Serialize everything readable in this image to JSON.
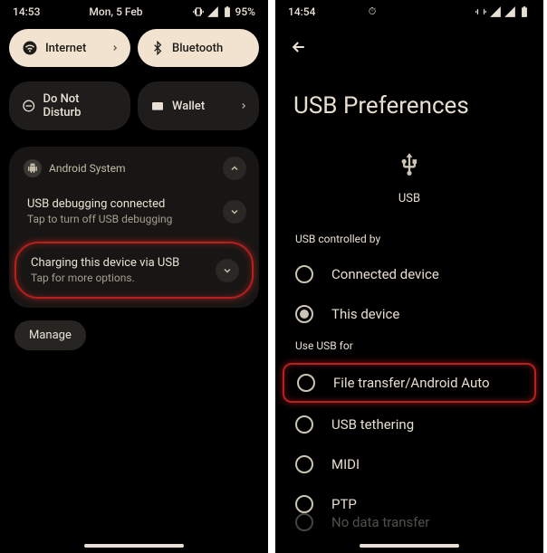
{
  "left": {
    "status": {
      "time": "14:53",
      "date": "Mon, 5 Feb",
      "battery": "95%"
    },
    "tiles": [
      {
        "label": "Internet",
        "icon": "wifi-icon",
        "variant": "light"
      },
      {
        "label": "Bluetooth",
        "icon": "bluetooth-icon",
        "variant": "light"
      },
      {
        "label": "Do Not Disturb",
        "icon": "dnd-icon",
        "variant": "dark"
      },
      {
        "label": "Wallet",
        "icon": "wallet-icon",
        "variant": "dark"
      }
    ],
    "notification_group": {
      "app": "Android System",
      "items": [
        {
          "title": "USB debugging connected",
          "sub": "Tap to turn off USB debugging"
        },
        {
          "title": "Charging this device via USB",
          "sub": "Tap for more options.",
          "highlighted": true
        }
      ]
    },
    "manage_label": "Manage"
  },
  "right": {
    "status": {
      "time": "14:54"
    },
    "title": "USB Preferences",
    "usb_label": "USB",
    "section1_label": "USB controlled by",
    "controlled_by": [
      {
        "label": "Connected device",
        "checked": false
      },
      {
        "label": "This device",
        "checked": true
      }
    ],
    "section2_label": "Use USB for",
    "use_for": [
      {
        "label": "File transfer/Android Auto",
        "checked": false,
        "highlighted": true
      },
      {
        "label": "USB tethering",
        "checked": false
      },
      {
        "label": "MIDI",
        "checked": false
      },
      {
        "label": "PTP",
        "checked": false
      },
      {
        "label": "No data transfer",
        "checked": false,
        "faded": true
      }
    ]
  }
}
